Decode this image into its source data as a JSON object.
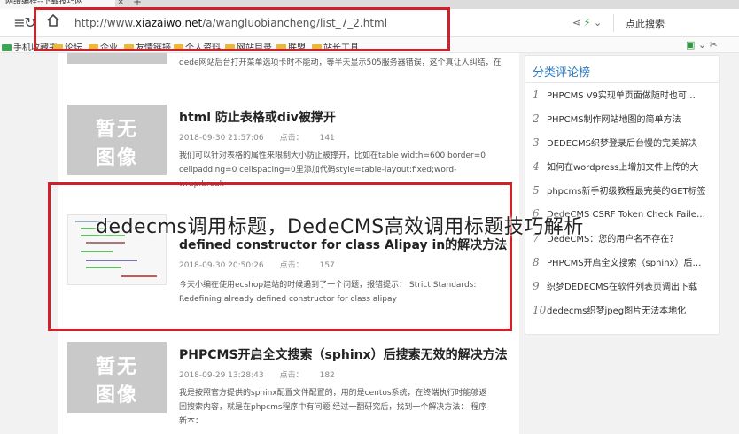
{
  "browser": {
    "tab_title": "网络编程--下载技巧网",
    "url_prefix": "http://www.",
    "url_domain": "xiazaiwo.net",
    "url_path": "/a/wangluobiancheng/list_7_2.html",
    "search_label": "点此搜索"
  },
  "bookmarks": [
    {
      "label": "手机收藏夹"
    },
    {
      "label": "论坛"
    },
    {
      "label": "企业"
    },
    {
      "label": "友情链接"
    },
    {
      "label": "个人资料"
    },
    {
      "label": "网站目录"
    },
    {
      "label": "联盟"
    },
    {
      "label": "站长工具"
    }
  ],
  "fragment_text": "dede网站后台打开菜单选项卡时不能动，等半天显示505服务器错误，这个真让人纠结，在",
  "placeholder_thumb": {
    "line1": "暂无",
    "line2": "图像"
  },
  "articles": [
    {
      "title": "html 防止表格或div被撑开",
      "date": "2018-09-30 21:57:06",
      "hits_label": "点击：",
      "hits": "141",
      "desc": "我们可以针对表格的属性来限制大小防止被撑开，比如在table width=600 border=0 cellpadding=0 cellspacing=0里添加代码style=table-layout:fixed;word-wrap:break-"
    },
    {
      "title": "defined constructor for class Alipay in的解决方法",
      "date": "2018-09-30 20:50:26",
      "hits_label": "点击：",
      "hits": "157",
      "desc": "今天小编在使用ecshop建站的时候遇到了一个问题，报错提示： Strict Standards: Redefining already defined constructor for class alipay"
    },
    {
      "title": "PHPCMS开启全文搜索（sphinx）后搜索无效的解决方法",
      "date": "2018-09-29 13:28:43",
      "hits_label": "点击：",
      "hits": "182",
      "desc": "我是按照官方提供的sphinx配置文件配置的，用的是centos系统，在终端执行时能够返回搜索内容，就是在phpcms程序中有问题 经过一翻研究后，找到一个解决方法： 程序新本："
    }
  ],
  "sidebar": {
    "title": "分类评论榜",
    "items": [
      {
        "num": "1",
        "label": "PHPCMS V9实现单页面做随时也可…"
      },
      {
        "num": "2",
        "label": "PHPCMS制作网站地图的简单方法"
      },
      {
        "num": "3",
        "label": "DEDECMS织梦登录后台慢的完美解决"
      },
      {
        "num": "4",
        "label": "如何在wordpress上增加文件上传的大"
      },
      {
        "num": "5",
        "label": "phpcms新手初级教程最完美的GET标签"
      },
      {
        "num": "6",
        "label": "DedeCMS CSRF Token Check Faile…"
      },
      {
        "num": "7",
        "label": "DedeCMS：您的用户名不存在？"
      },
      {
        "num": "8",
        "label": "PHPCMS开启全文搜索（sphinx）后…"
      },
      {
        "num": "9",
        "label": "织梦DEDECMS在软件列表页调出下载"
      },
      {
        "num": "10",
        "label": "dedecms织梦jpeg图片无法本地化"
      }
    ]
  },
  "overlay_title": "dedecms调用标题，DedeCMS高效调用标题技巧解析",
  "colors": {
    "highlight_box": "#d0202a",
    "sidebar_title": "#2b7bc4"
  }
}
